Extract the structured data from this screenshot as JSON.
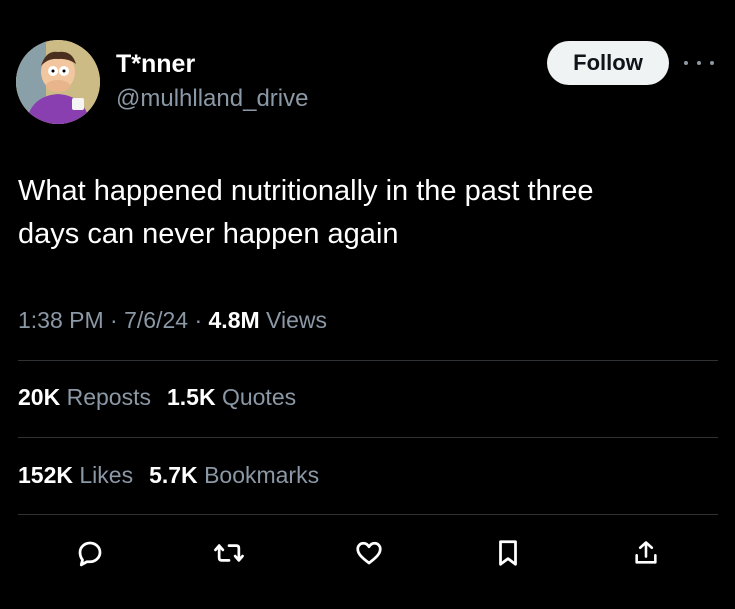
{
  "author": {
    "display_name": "T*nner",
    "handle": "@mulhlland_drive",
    "avatar_icon": "cartoon-avatar"
  },
  "follow_label": "Follow",
  "tweet": {
    "text_line1": "What happened nutritionally in the past three",
    "text_line2": "days can never happen again"
  },
  "meta": {
    "time": "1:38 PM",
    "sep1": " · ",
    "date": "7/6/24",
    "sep2": " · ",
    "views_count": "4.8M",
    "views_label": "Views"
  },
  "stats": {
    "reposts_count": "20K",
    "reposts_label": "Reposts",
    "quotes_count": "1.5K",
    "quotes_label": "Quotes",
    "likes_count": "152K",
    "likes_label": "Likes",
    "bookmarks_count": "5.7K",
    "bookmarks_label": "Bookmarks"
  },
  "actions": [
    "reply-icon",
    "repost-icon",
    "like-icon",
    "bookmark-icon",
    "share-icon"
  ],
  "colors": {
    "background": "#000000",
    "primary_text": "#ffffff",
    "secondary_text": "#8b98a5",
    "follow_bg": "#eff3f4",
    "divider": "#2f3336"
  }
}
